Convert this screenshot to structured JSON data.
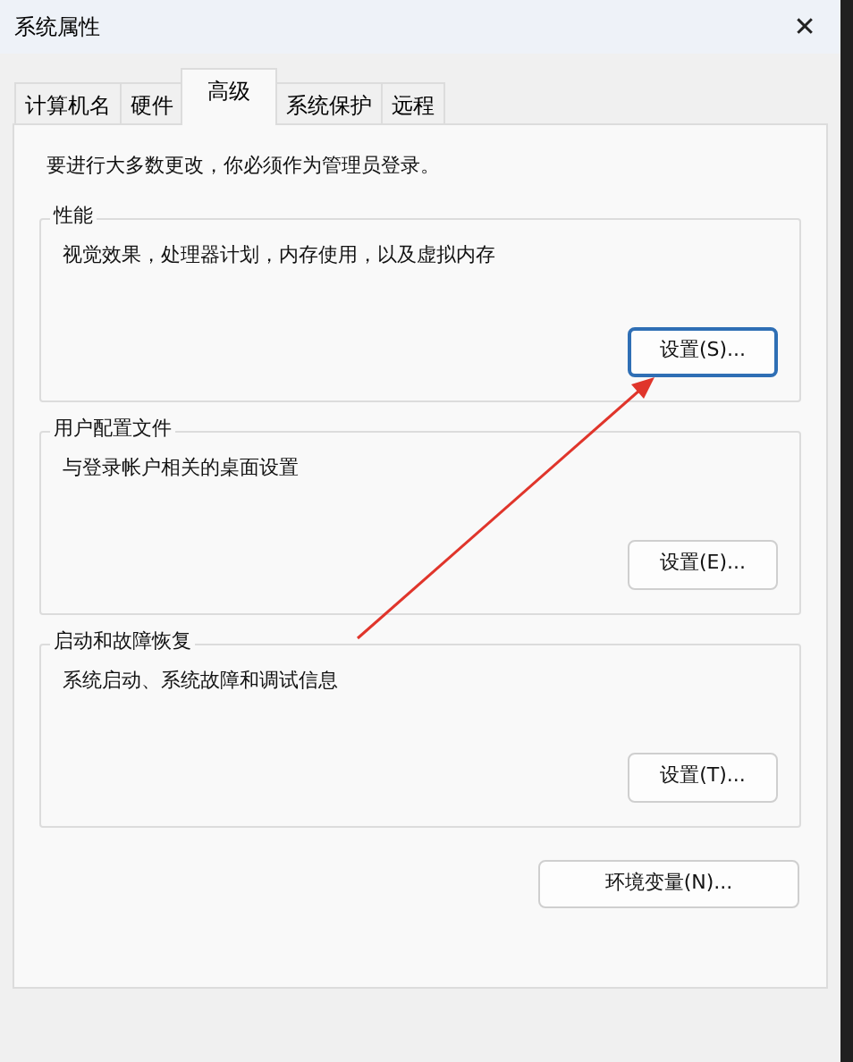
{
  "window": {
    "title": "系统属性",
    "close": "✕"
  },
  "tabs": [
    {
      "label": "计算机名",
      "selected": false
    },
    {
      "label": "硬件",
      "selected": false
    },
    {
      "label": "高级",
      "selected": true
    },
    {
      "label": "系统保护",
      "selected": false
    },
    {
      "label": "远程",
      "selected": false
    }
  ],
  "notice": "要进行大多数更改，你必须作为管理员登录。",
  "groups": [
    {
      "title": "性能",
      "description": "视觉效果，处理器计划，内存使用，以及虚拟内存",
      "button": "设置(S)...",
      "focused": true
    },
    {
      "title": "用户配置文件",
      "description": "与登录帐户相关的桌面设置",
      "button": "设置(E)...",
      "focused": false
    },
    {
      "title": "启动和故障恢复",
      "description": "系统启动、系统故障和调试信息",
      "button": "设置(T)...",
      "focused": false
    }
  ],
  "env_button": "环境变量(N)..."
}
